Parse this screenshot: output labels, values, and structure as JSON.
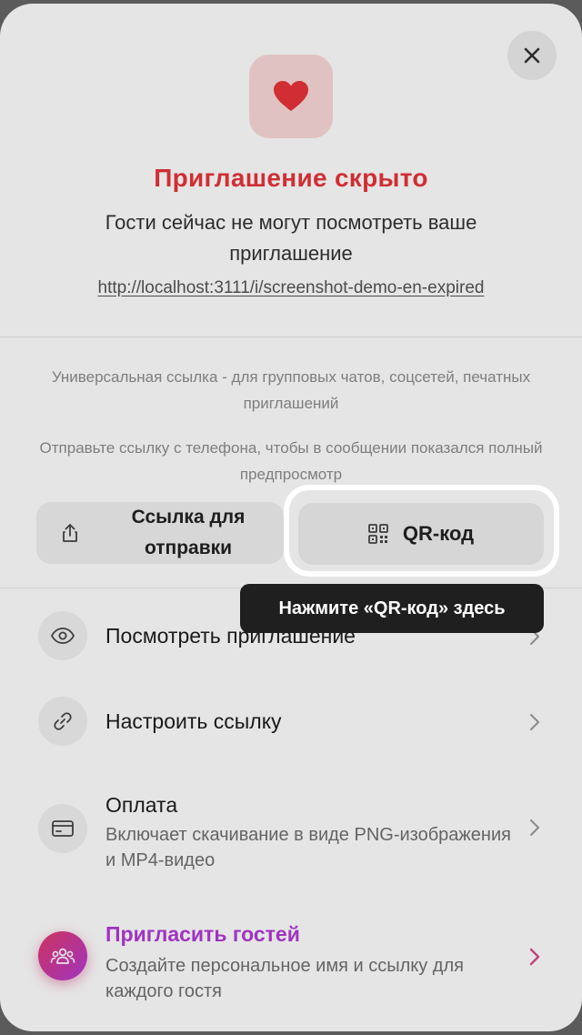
{
  "header": {
    "close_icon": "close-icon",
    "hero_icon": "heart-icon",
    "title": "Приглашение скрыто",
    "subtitle": "Гости сейчас не могут посмотреть ваше приглашение",
    "url": "http://localhost:3111/i/screenshot-demo-en-expired"
  },
  "share": {
    "hint1": "Универсальная ссылка - для групповых чатов, соцсетей, печатных приглашений",
    "hint2": "Отправьте ссылку с телефона, чтобы в сообщении показался полный предпросмотр",
    "share_button_label": "Ссылка для отправки",
    "share_icon": "share-icon",
    "qr_button_label": "QR-код",
    "qr_icon": "qr-code-icon"
  },
  "tooltip": {
    "text": "Нажмите «QR-код» здесь"
  },
  "menu": {
    "view": {
      "title": "Посмотреть приглашение",
      "icon": "eye-icon"
    },
    "link": {
      "title": "Настроить ссылку",
      "icon": "link-icon"
    },
    "payment": {
      "title": "Оплата",
      "desc": "Включает скачивание в виде PNG-изображения и MP4-видео",
      "icon": "credit-card-icon"
    },
    "guests": {
      "title": "Пригласить гостей",
      "desc": "Создайте персональное имя и ссылку для каждого гостя",
      "icon": "guests-icon"
    }
  },
  "colors": {
    "accent_red": "#e8343a",
    "accent_purple": "#b23ad6",
    "tooltip_bg": "#1f1f1f"
  }
}
